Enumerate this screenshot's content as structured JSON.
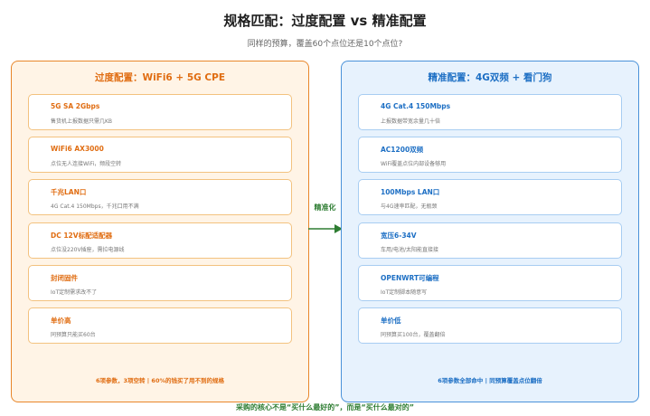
{
  "header": {
    "title": "规格匹配：过度配置 vs 精准配置",
    "subtitle": "同样的预算，覆盖60个点位还是10个点位?"
  },
  "left_panel": {
    "title": "过度配置：WiFi6 + 5G CPE",
    "cards": [
      {
        "title": "5G SA 2Gbps",
        "desc": "售货机上报数据只需几KB"
      },
      {
        "title": "WiFi6 AX3000",
        "desc": "点位无人连接WiFi，频段空转"
      },
      {
        "title": "千兆LAN口",
        "desc": "4G Cat.4 150Mbps，千兆口用不满"
      },
      {
        "title": "DC 12V标配适配器",
        "desc": "点位没220V插座，需拉电源线"
      },
      {
        "title": "封闭固件",
        "desc": "IoT定制需求改不了"
      },
      {
        "title": "单价高",
        "desc": "同预算只能买60台"
      }
    ],
    "footer": "6项参数，3项空转 | 60%的钱买了用不到的规格"
  },
  "right_panel": {
    "title": "精准配置：4G双频 + 看门狗",
    "cards": [
      {
        "title": "4G Cat.4 150Mbps",
        "desc": "上报数据带宽余量几十倍"
      },
      {
        "title": "AC1200双频",
        "desc": "WiFi覆盖点位内部设备够用"
      },
      {
        "title": "100Mbps LAN口",
        "desc": "与4G速率匹配，无瓶颈"
      },
      {
        "title": "宽压6-34V",
        "desc": "车用/电池/太阳能直接接"
      },
      {
        "title": "OPENWRT可编程",
        "desc": "IoT定制脚本随意写"
      },
      {
        "title": "单价低",
        "desc": "同预算买100台，覆盖翻倍"
      }
    ],
    "footer": "6项参数全部命中 | 同预算覆盖点位翻倍"
  },
  "connector": {
    "label": "精准化",
    "color": "#2e7d32"
  },
  "bottom_note": "采购的核心不是“买什么最好的”，而是“买什么最对的”",
  "colors": {
    "left_accent": "#e06d12",
    "left_border": "#e8862a",
    "left_bg": "#fff4e6",
    "right_accent": "#1d6fc4",
    "right_border": "#4a92d9",
    "right_bg": "#e7f2fd"
  }
}
